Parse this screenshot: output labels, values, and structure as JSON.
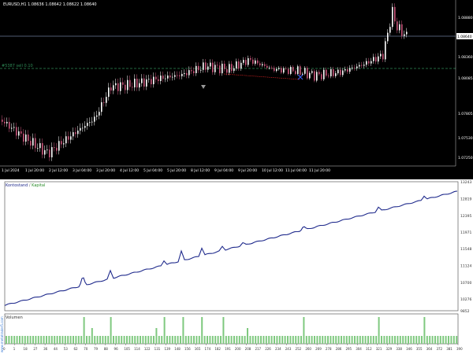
{
  "price_chart": {
    "symbol_info": "EURUSD,H1  1.08636 1.08642 1.08622 1.08640",
    "level_label": "#5387 sell 0.10",
    "current_price": "1.08640",
    "price_ticks": [
      "1.08880",
      "1.08640",
      "1.08360",
      "1.08085",
      "1.07805",
      "1.07530",
      "1.07250"
    ],
    "time_ticks": [
      "1 Jul 2024",
      "1 Jul 20:00",
      "2 Jul 12:00",
      "3 Jul 04:00",
      "3 Jul 20:00",
      "4 Jul 12:00",
      "5 Jul 04:00",
      "5 Jul 20:00",
      "8 Jul 12:00",
      "9 Jul 04:00",
      "9 Jul 20:00",
      "10 Jul 12:00",
      "11 Jul 04:00",
      "11 Jul 20:00"
    ],
    "colors": {
      "background": "#000000",
      "bull": "#ffffff",
      "bear": "#c8557a",
      "grid_line": "#6c7a99",
      "trade_line": "#2e8b57",
      "arrow": "#3b63ff"
    }
  },
  "balance_chart": {
    "legend_balance": "Kontostand",
    "legend_separator": " / ",
    "legend_equity": "Kapital",
    "value_ticks": [
      "13243",
      "12819",
      "12395",
      "11971",
      "11548",
      "11124",
      "10700",
      "10276",
      "9852"
    ],
    "volume_label": "Volumen",
    "x_ticks": [
      "0",
      "1",
      "18",
      "27",
      "36",
      "44",
      "53",
      "62",
      "70",
      "79",
      "88",
      "96",
      "105",
      "114",
      "122",
      "131",
      "139",
      "148",
      "156",
      "165",
      "174",
      "182",
      "191",
      "200",
      "208",
      "217",
      "226",
      "234",
      "243",
      "252",
      "260",
      "269",
      "278",
      "286",
      "295",
      "304",
      "312",
      "321",
      "329",
      "338",
      "346",
      "355",
      "364",
      "372",
      "381",
      "390"
    ],
    "watermark": "www.metatrader5.com",
    "colors": {
      "balance": "#1f2a8c",
      "equity": "#2a8c2a",
      "volume": "#7fc97f",
      "axis": "#444444"
    }
  }
}
